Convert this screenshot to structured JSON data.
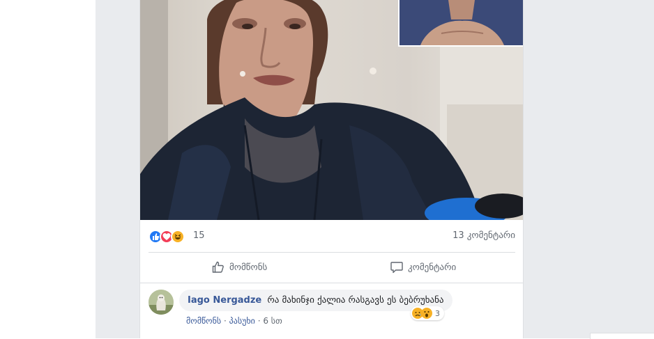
{
  "post": {
    "reaction_count": "15",
    "comment_count_label": "13 კომენტარი",
    "actions": {
      "like_label": "მომწონს",
      "comment_label": "კომენტარი"
    },
    "reactions": [
      "like-icon",
      "love-icon",
      "haha-icon"
    ]
  },
  "comment": {
    "author": "Iago Nergadze",
    "text": "რა მახინჯი ქალია რასგავს ეს ბებრუხანა",
    "reaction_count": "3",
    "reactions": [
      "sad-icon",
      "wow-icon"
    ],
    "like_label": "მომწონს",
    "reply_label": "პასუხი",
    "time": "6 სთ",
    "separator": "·"
  },
  "colors": {
    "feed_background": "#e9ebee",
    "link_blue": "#385898",
    "like_blue": "#2078f4",
    "love_red": "#f33e58",
    "haha_yellow": "#f7b125"
  }
}
